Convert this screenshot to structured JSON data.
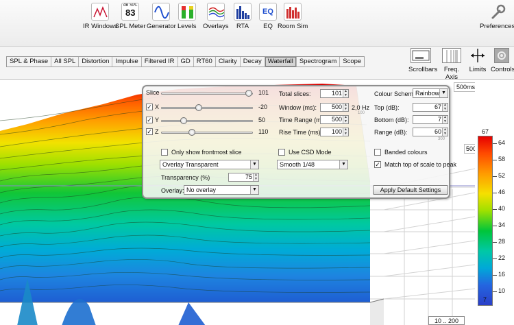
{
  "toolbar": {
    "items": [
      {
        "label": "IR Windows",
        "icon": "ir-windows-icon"
      },
      {
        "label": "SPL Meter",
        "icon": "spl-meter-icon",
        "icon_top": "dB SPL",
        "icon_value": "83"
      },
      {
        "label": "Generator",
        "icon": "generator-icon"
      },
      {
        "label": "Levels",
        "icon": "levels-icon"
      },
      {
        "label": "Overlays",
        "icon": "overlays-icon"
      },
      {
        "label": "RTA",
        "icon": "rta-icon"
      },
      {
        "label": "EQ",
        "icon": "eq-icon",
        "icon_text": "EQ"
      },
      {
        "label": "Room Sim",
        "icon": "room-sim-icon"
      }
    ],
    "preferences": "Preferences"
  },
  "tabs": [
    "SPL & Phase",
    "All SPL",
    "Distortion",
    "Impulse",
    "Filtered IR",
    "GD",
    "RT60",
    "Clarity",
    "Decay",
    "Waterfall",
    "Spectrogram",
    "Scope"
  ],
  "active_tab": "Waterfall",
  "right_tools": [
    "Scrollbars",
    "Freq. Axis",
    "Limits",
    "Controls"
  ],
  "plot": {
    "ms_readout": "500ms",
    "freq_label": "500",
    "range_box": "10 .. 200"
  },
  "scale": {
    "top": "67",
    "bottom": "7",
    "ticks": [
      "64",
      "58",
      "52",
      "46",
      "40",
      "34",
      "28",
      "22",
      "16",
      "10"
    ]
  },
  "controls": {
    "slice": {
      "label": "Slice",
      "value": "101",
      "pos": 1.0
    },
    "x": {
      "label": "X",
      "value": "-20",
      "checked": true,
      "pos": 0.4
    },
    "y": {
      "label": "Y",
      "value": "50",
      "checked": true,
      "pos": 0.22
    },
    "z": {
      "label": "Z",
      "value": "110",
      "checked": true,
      "pos": 0.32
    },
    "total_slices": {
      "label": "Total slices:",
      "value": "101"
    },
    "window": {
      "label": "Window (ms):",
      "value": "500",
      "extra": "2,0 Hz",
      "hint": "100"
    },
    "time_range": {
      "label": "Time Range (ms):",
      "value": "500"
    },
    "rise_time": {
      "label": "Rise Time (ms):",
      "value": "100"
    },
    "colour_scheme": {
      "label": "Colour Scheme:",
      "value": "Rainbow"
    },
    "top_db": {
      "label": "Top (dB):",
      "value": "67"
    },
    "bottom_db": {
      "label": "Bottom (dB):",
      "value": "7"
    },
    "range_db": {
      "label": "Range (dB):",
      "value": "60",
      "hint": "300"
    },
    "frontmost": {
      "label": "Only show frontmost slice",
      "checked": false
    },
    "csd": {
      "label": "Use CSD Mode",
      "checked": false
    },
    "banded": {
      "label": "Banded colours",
      "checked": false
    },
    "match_top": {
      "label": "Match top of scale to peak",
      "checked": true
    },
    "overlay_mode": "Overlay Transparent",
    "smoothing": "Smooth 1/48",
    "transparency": {
      "label": "Transparency (%)",
      "value": "75"
    },
    "overlay": {
      "label": "Overlay:",
      "value": "No overlay"
    },
    "apply_button": "Apply Default Settings"
  }
}
